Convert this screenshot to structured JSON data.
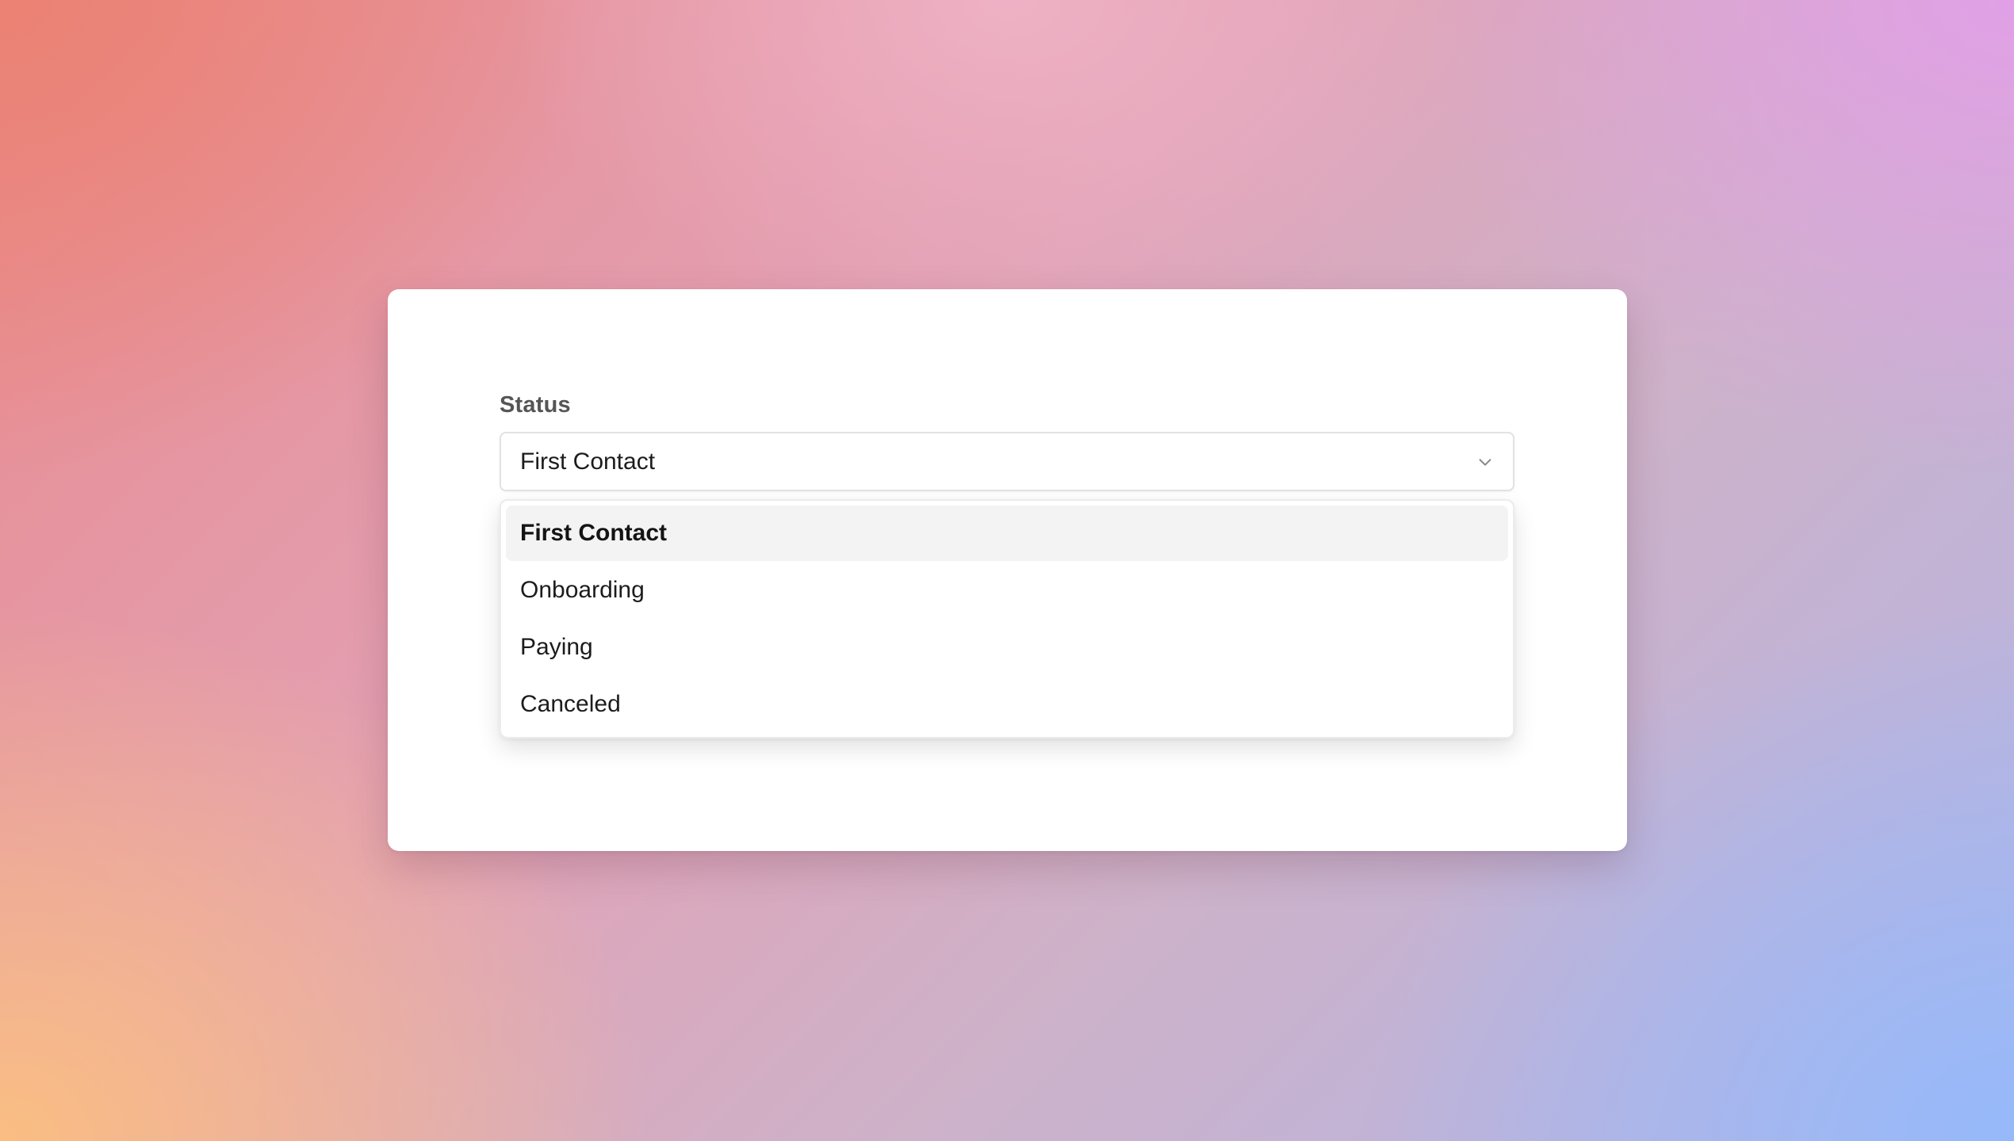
{
  "colors": {
    "card_background": "#ffffff",
    "label_text": "#555555",
    "option_text": "#1c1c1c",
    "selected_option_background": "#f3f3f3"
  },
  "form": {
    "status_label": "Status",
    "select": {
      "value": "First Contact",
      "icon": "chevron-down-icon"
    },
    "options": [
      {
        "label": "First Contact",
        "selected": true
      },
      {
        "label": "Onboarding",
        "selected": false
      },
      {
        "label": "Paying",
        "selected": false
      },
      {
        "label": "Canceled",
        "selected": false
      }
    ]
  }
}
